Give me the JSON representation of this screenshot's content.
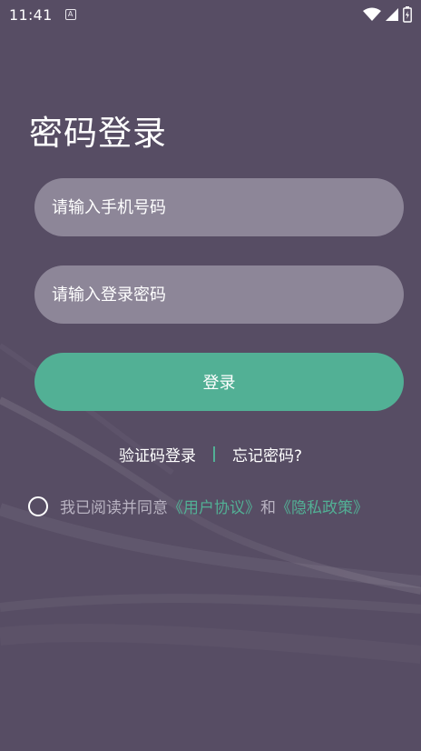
{
  "status_bar": {
    "time": "11:41",
    "notification_icon_glyph": "A",
    "icons": [
      "wifi-icon",
      "signal-icon",
      "battery-icon"
    ]
  },
  "page": {
    "title": "密码登录"
  },
  "form": {
    "phone_placeholder": "请输入手机号码",
    "password_placeholder": "请输入登录密码",
    "login_label": "登录"
  },
  "links": {
    "sms_login": "验证码登录",
    "forgot_password": "忘记密码?"
  },
  "agreement": {
    "prefix": "我已阅读并同意",
    "user_agreement": "《用户协议》",
    "and": "和",
    "privacy_policy": "《隐私政策》"
  },
  "colors": {
    "background": "#574d64",
    "field_bg": "#8d8698",
    "accent": "#52b095",
    "muted_text": "#b9b3c2"
  }
}
